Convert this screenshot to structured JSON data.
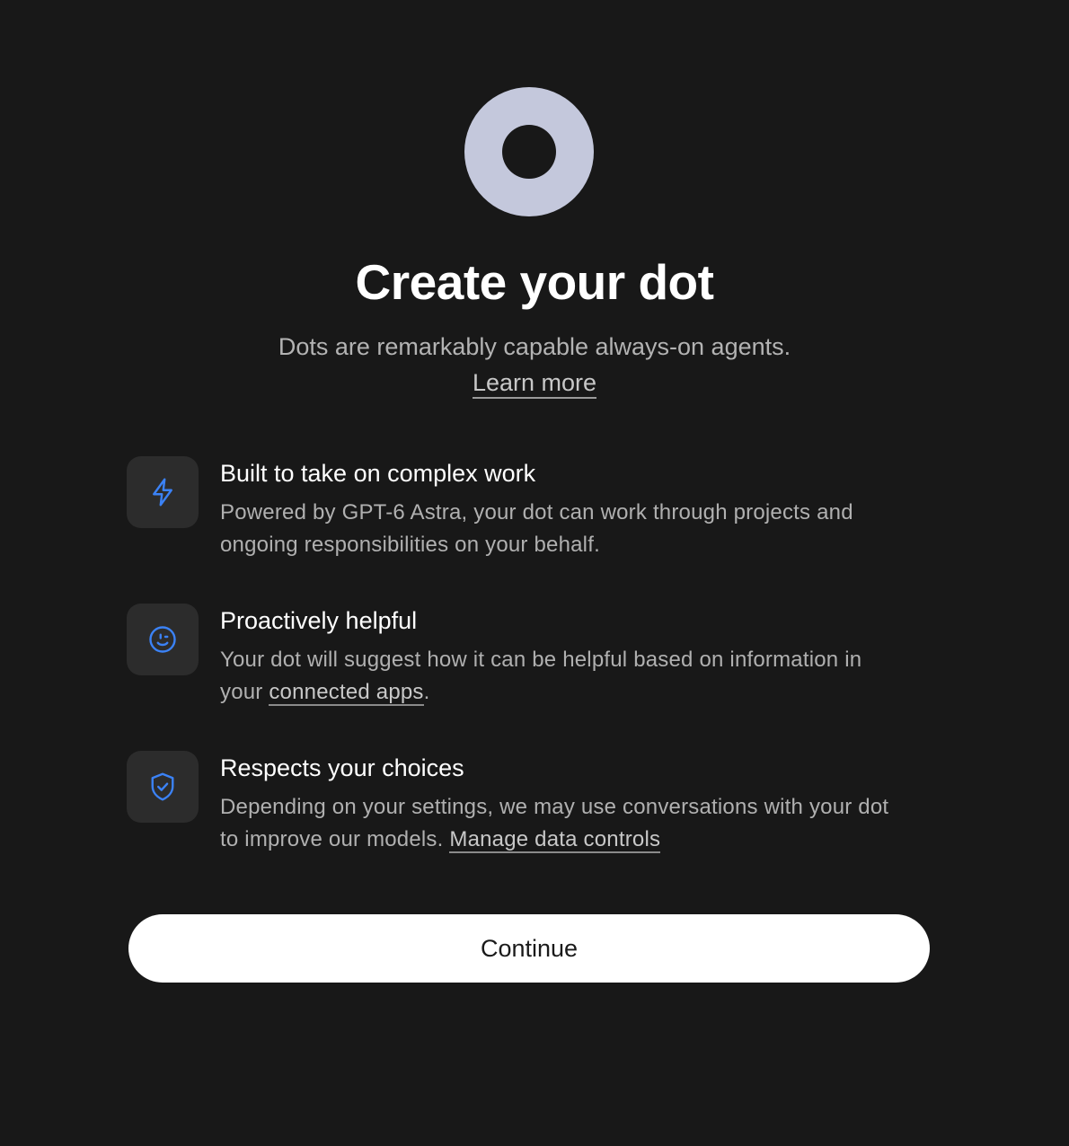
{
  "hero": {
    "title": "Create your dot",
    "subtitle": "Dots are remarkably capable always-on agents.",
    "learn_more": "Learn more"
  },
  "features": [
    {
      "icon": "lightning-bolt-icon",
      "title": "Built to take on complex work",
      "body_line1": "Powered by GPT-6 Astra, your dot can work through projects and",
      "body_line2": "ongoing responsibilities on your behalf."
    },
    {
      "icon": "smiley-face-icon",
      "title": "Proactively helpful",
      "body_line1": "Your dot will suggest how it can be helpful based on information in",
      "body_prefix": "your ",
      "link": "connected apps",
      "body_suffix": "."
    },
    {
      "icon": "shield-check-icon",
      "title": "Respects your choices",
      "body_line1": "Depending on your settings, we may use conversations with your dot",
      "body_prefix": "to improve our models. ",
      "link": "Manage data controls"
    }
  ],
  "actions": {
    "continue_label": "Continue"
  },
  "colors": {
    "background": "#181818",
    "icon_accent": "#3b82f6",
    "logo_ring": "#c4c8dc"
  }
}
